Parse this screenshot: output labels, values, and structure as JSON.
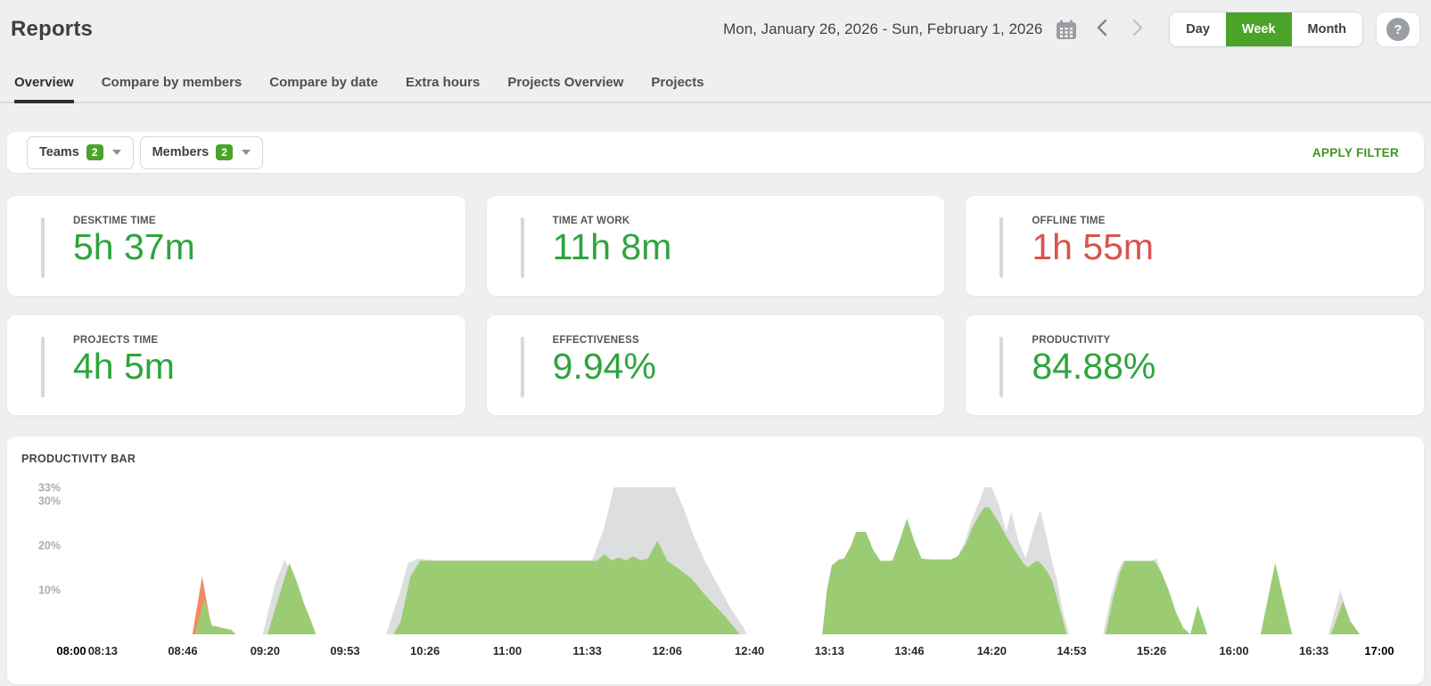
{
  "header": {
    "title": "Reports",
    "date_range": "Mon, January 26, 2026 - Sun, February 1, 2026",
    "view_options": [
      "Day",
      "Week",
      "Month"
    ],
    "active_view": "Week",
    "help_label": "?"
  },
  "tabs": [
    {
      "label": "Overview",
      "active": true
    },
    {
      "label": "Compare by members",
      "active": false
    },
    {
      "label": "Compare by date",
      "active": false
    },
    {
      "label": "Extra hours",
      "active": false
    },
    {
      "label": "Projects Overview",
      "active": false
    },
    {
      "label": "Projects",
      "active": false
    }
  ],
  "filters": {
    "teams_label": "Teams",
    "teams_count": "2",
    "members_label": "Members",
    "members_count": "2",
    "apply_label": "APPLY FILTER"
  },
  "stats": [
    {
      "label": "DESKTIME TIME",
      "value": "5h 37m",
      "color": "green"
    },
    {
      "label": "TIME AT WORK",
      "value": "11h 8m",
      "color": "green"
    },
    {
      "label": "OFFLINE TIME",
      "value": "1h 55m",
      "color": "red"
    },
    {
      "label": "PROJECTS TIME",
      "value": "4h 5m",
      "color": "green"
    },
    {
      "label": "EFFECTIVENESS",
      "value": "9.94%",
      "color": "green"
    },
    {
      "label": "PRODUCTIVITY",
      "value": "84.88%",
      "color": "green"
    }
  ],
  "chart_data": {
    "type": "area",
    "title": "PRODUCTIVITY BAR",
    "x_unit": "minutes since 08:00",
    "x_range": [
      0,
      540
    ],
    "y_max": 36,
    "grid": false,
    "legend": "none",
    "y_ticks": [
      {
        "label": "33%",
        "value": 33
      },
      {
        "label": "30%",
        "value": 30
      },
      {
        "label": "20%",
        "value": 20
      },
      {
        "label": "10%",
        "value": 10
      }
    ],
    "x_ticks": [
      {
        "label": "08:00",
        "min": 0,
        "bold": true
      },
      {
        "label": "08:13",
        "min": 13,
        "bold": false
      },
      {
        "label": "08:46",
        "min": 46,
        "bold": false
      },
      {
        "label": "09:20",
        "min": 80,
        "bold": false
      },
      {
        "label": "09:53",
        "min": 113,
        "bold": false
      },
      {
        "label": "10:26",
        "min": 146,
        "bold": false
      },
      {
        "label": "11:00",
        "min": 180,
        "bold": false
      },
      {
        "label": "11:33",
        "min": 213,
        "bold": false
      },
      {
        "label": "12:06",
        "min": 246,
        "bold": false
      },
      {
        "label": "12:40",
        "min": 280,
        "bold": false
      },
      {
        "label": "13:13",
        "min": 313,
        "bold": false
      },
      {
        "label": "13:46",
        "min": 346,
        "bold": false
      },
      {
        "label": "14:20",
        "min": 380,
        "bold": false
      },
      {
        "label": "14:53",
        "min": 413,
        "bold": false
      },
      {
        "label": "15:26",
        "min": 446,
        "bold": false
      },
      {
        "label": "16:00",
        "min": 480,
        "bold": false
      },
      {
        "label": "16:33",
        "min": 513,
        "bold": false
      },
      {
        "label": "17:00",
        "min": 540,
        "bold": true
      }
    ],
    "series": [
      {
        "name": "neutral-total-time",
        "color": "#dddedf",
        "points": [
          [
            0,
            0
          ],
          [
            79,
            0
          ],
          [
            84,
            11
          ],
          [
            88,
            16.8
          ],
          [
            91,
            13.5
          ],
          [
            94,
            8
          ],
          [
            97,
            3
          ],
          [
            99,
            0
          ],
          [
            130,
            0
          ],
          [
            133,
            5
          ],
          [
            136,
            10
          ],
          [
            139,
            16
          ],
          [
            143,
            17
          ],
          [
            150,
            16.6
          ],
          [
            215,
            16.6
          ],
          [
            220,
            24
          ],
          [
            224,
            33
          ],
          [
            249,
            33
          ],
          [
            253,
            28
          ],
          [
            257,
            22
          ],
          [
            262,
            16
          ],
          [
            267,
            11
          ],
          [
            272,
            6
          ],
          [
            277,
            2
          ],
          [
            279,
            0
          ],
          [
            310,
            0
          ],
          [
            312,
            10
          ],
          [
            314,
            15.5
          ],
          [
            317,
            16.8
          ],
          [
            319,
            17
          ],
          [
            322,
            20
          ],
          [
            324,
            23
          ],
          [
            328,
            23
          ],
          [
            331,
            19
          ],
          [
            334,
            16.5
          ],
          [
            339,
            16.5
          ],
          [
            342,
            21
          ],
          [
            345,
            26
          ],
          [
            348,
            21
          ],
          [
            351,
            17
          ],
          [
            355,
            16.8
          ],
          [
            363,
            16.8
          ],
          [
            366,
            17.5
          ],
          [
            369,
            21
          ],
          [
            372,
            26
          ],
          [
            375,
            30
          ],
          [
            377,
            33
          ],
          [
            380,
            33
          ],
          [
            383,
            29
          ],
          [
            385,
            25
          ],
          [
            386,
            23
          ],
          [
            388,
            27.5
          ],
          [
            391,
            21
          ],
          [
            394,
            17
          ],
          [
            397,
            23
          ],
          [
            400,
            28
          ],
          [
            403,
            21
          ],
          [
            405,
            16
          ],
          [
            407,
            12
          ],
          [
            409,
            6
          ],
          [
            412,
            0
          ],
          [
            426,
            0
          ],
          [
            429,
            8
          ],
          [
            432,
            14
          ],
          [
            434,
            16.5
          ],
          [
            446,
            16.5
          ],
          [
            448,
            17
          ],
          [
            451,
            12
          ],
          [
            454,
            7
          ],
          [
            457,
            2
          ],
          [
            459,
            0
          ],
          [
            519,
            0
          ],
          [
            524,
            10
          ],
          [
            527,
            4
          ],
          [
            530,
            0
          ],
          [
            540,
            0
          ]
        ]
      },
      {
        "name": "unproductive-time",
        "color": "#f28b5f",
        "points": [
          [
            0,
            0
          ],
          [
            50,
            0
          ],
          [
            54,
            13
          ],
          [
            58,
            1
          ],
          [
            60,
            0
          ],
          [
            540,
            0
          ]
        ]
      },
      {
        "name": "productive-time",
        "color": "#9bcc74",
        "points": [
          [
            0,
            0
          ],
          [
            51,
            0
          ],
          [
            55,
            8
          ],
          [
            58,
            2
          ],
          [
            62,
            1.5
          ],
          [
            66,
            1
          ],
          [
            68,
            0
          ],
          [
            81,
            0
          ],
          [
            86,
            9
          ],
          [
            90,
            16
          ],
          [
            93,
            12
          ],
          [
            96,
            7
          ],
          [
            99,
            3
          ],
          [
            101,
            0
          ],
          [
            133,
            0
          ],
          [
            136,
            3
          ],
          [
            140,
            13
          ],
          [
            144,
            16.5
          ],
          [
            217,
            16.5
          ],
          [
            220,
            18
          ],
          [
            223,
            16.6
          ],
          [
            226,
            17.3
          ],
          [
            229,
            16.6
          ],
          [
            232,
            17.5
          ],
          [
            235,
            16.6
          ],
          [
            238,
            17
          ],
          [
            242,
            21
          ],
          [
            246,
            16.5
          ],
          [
            250,
            15
          ],
          [
            256,
            12.5
          ],
          [
            263,
            8
          ],
          [
            270,
            4
          ],
          [
            276,
            0
          ],
          [
            310,
            0
          ],
          [
            312,
            10
          ],
          [
            314,
            15.5
          ],
          [
            317,
            16.8
          ],
          [
            319,
            17
          ],
          [
            322,
            20
          ],
          [
            324,
            23
          ],
          [
            328,
            23
          ],
          [
            331,
            19
          ],
          [
            334,
            16.5
          ],
          [
            339,
            16.5
          ],
          [
            342,
            21
          ],
          [
            345,
            26
          ],
          [
            348,
            21
          ],
          [
            351,
            17
          ],
          [
            355,
            16.8
          ],
          [
            363,
            16.8
          ],
          [
            366,
            17.5
          ],
          [
            369,
            20
          ],
          [
            372,
            24
          ],
          [
            375,
            27
          ],
          [
            377,
            28.5
          ],
          [
            379,
            28.5
          ],
          [
            383,
            25
          ],
          [
            386,
            22
          ],
          [
            390,
            18.5
          ],
          [
            393,
            16
          ],
          [
            395,
            15
          ],
          [
            397,
            16
          ],
          [
            399,
            16.5
          ],
          [
            401,
            15.5
          ],
          [
            403,
            14
          ],
          [
            405,
            12
          ],
          [
            407,
            8
          ],
          [
            409,
            4
          ],
          [
            411,
            0
          ],
          [
            427,
            0
          ],
          [
            430,
            8
          ],
          [
            433,
            14
          ],
          [
            435,
            16.5
          ],
          [
            447,
            16.5
          ],
          [
            450,
            14
          ],
          [
            453,
            10
          ],
          [
            456,
            5
          ],
          [
            459,
            1.5
          ],
          [
            462,
            0
          ],
          [
            465,
            6.5
          ],
          [
            469,
            0
          ],
          [
            491,
            0
          ],
          [
            497,
            16
          ],
          [
            504,
            0
          ],
          [
            520,
            0
          ],
          [
            525,
            7.5
          ],
          [
            528,
            3
          ],
          [
            532,
            0
          ],
          [
            540,
            0
          ]
        ]
      }
    ]
  },
  "colors": {
    "accent_green": "#4ba32a",
    "stat_green": "#2fa43c",
    "stat_red": "#d9534e",
    "chart_green": "#9bcc74",
    "chart_grey": "#dddedf",
    "chart_orange": "#f28b5f",
    "page_bg": "#efeff0"
  }
}
